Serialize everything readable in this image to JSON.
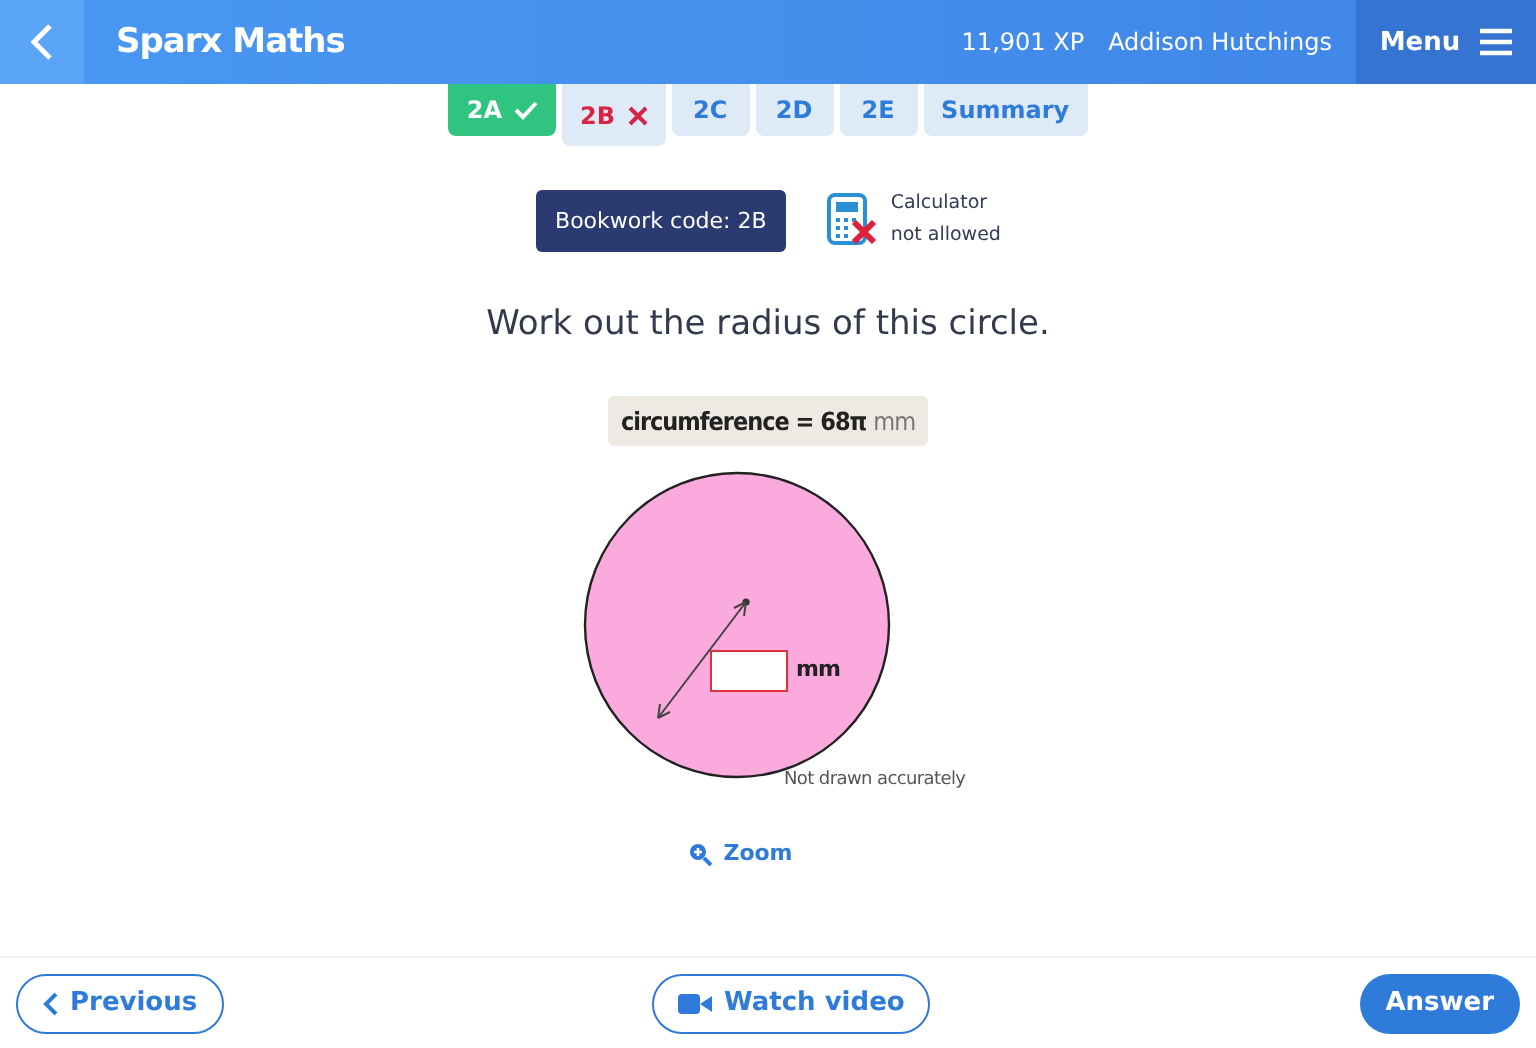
{
  "header": {
    "title": "Sparx Maths",
    "xp": "11,901 XP",
    "user": "Addison Hutchings",
    "menu": "Menu"
  },
  "tabs": [
    {
      "label": "2A",
      "kind": "correct",
      "selected": false
    },
    {
      "label": "2B",
      "kind": "wrong",
      "selected": true
    },
    {
      "label": "2C",
      "kind": "plain",
      "selected": false
    },
    {
      "label": "2D",
      "kind": "plain",
      "selected": false
    },
    {
      "label": "2E",
      "kind": "plain",
      "selected": false
    },
    {
      "label": "Summary",
      "kind": "plain",
      "selected": false
    }
  ],
  "bookwork_code": "Bookwork code: 2B",
  "calculator": {
    "allowed": false,
    "line1": "Calculator",
    "line2": "not allowed"
  },
  "question": "Work out the radius of this circle.",
  "given": {
    "expression": "circumference = 68π",
    "unit": "mm"
  },
  "answer_field": {
    "unit": "mm"
  },
  "note": "Not drawn accurately",
  "zoom": "Zoom",
  "footer": {
    "previous": "Previous",
    "video": "Watch video",
    "answer": "Answer"
  }
}
